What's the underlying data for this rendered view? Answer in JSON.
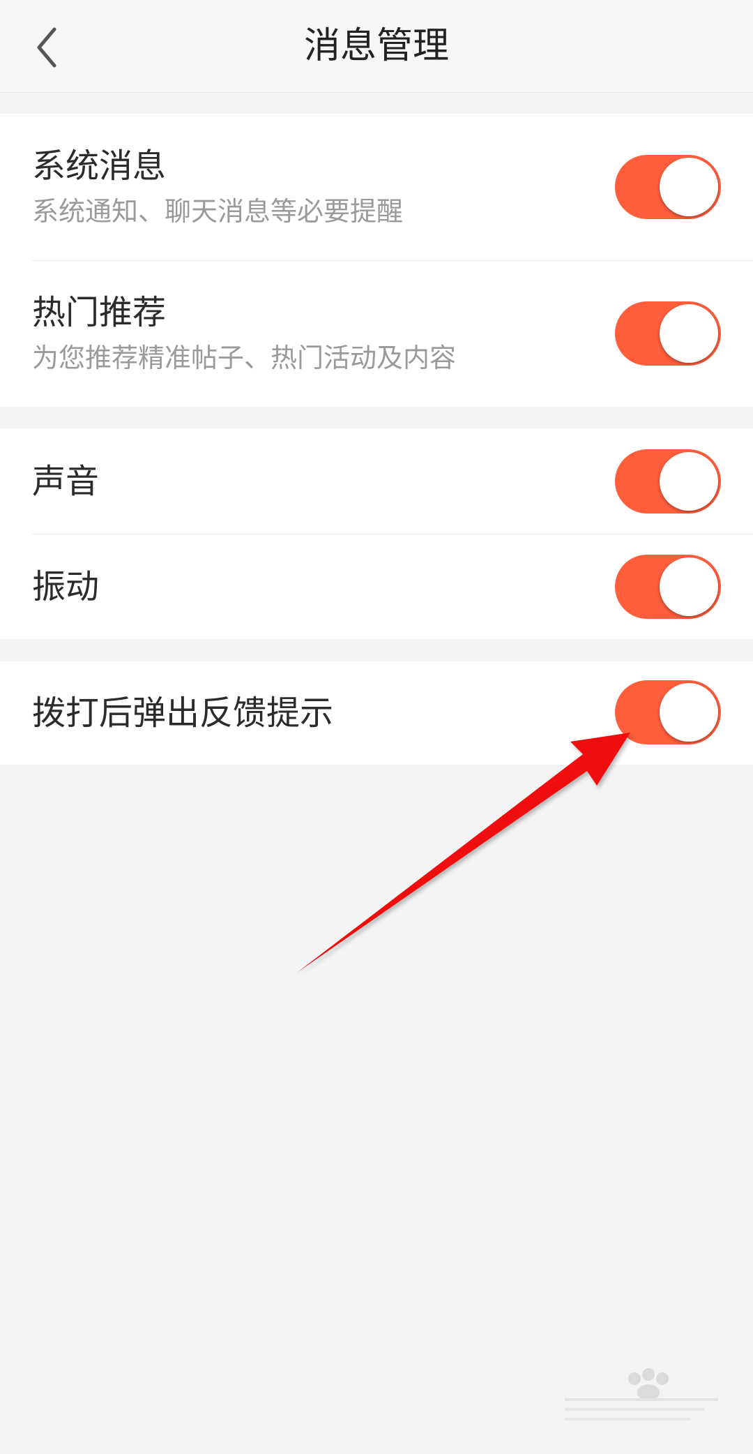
{
  "header": {
    "title": "消息管理",
    "back_icon": "chevron-left-icon"
  },
  "settings": {
    "system_messages": {
      "title": "系统消息",
      "subtitle": "系统通知、聊天消息等必要提醒",
      "enabled": true
    },
    "hot_recommendations": {
      "title": "热门推荐",
      "subtitle": "为您推荐精准帖子、热门活动及内容",
      "enabled": true
    },
    "sound": {
      "title": "声音",
      "enabled": true
    },
    "vibration": {
      "title": "振动",
      "enabled": true
    },
    "post_call_feedback": {
      "title": "拨打后弹出反馈提示",
      "enabled": true
    }
  },
  "colors": {
    "toggle_on": "#ff5e3c",
    "background": "#f4f4f4",
    "annotation_arrow": "#ff0000"
  }
}
